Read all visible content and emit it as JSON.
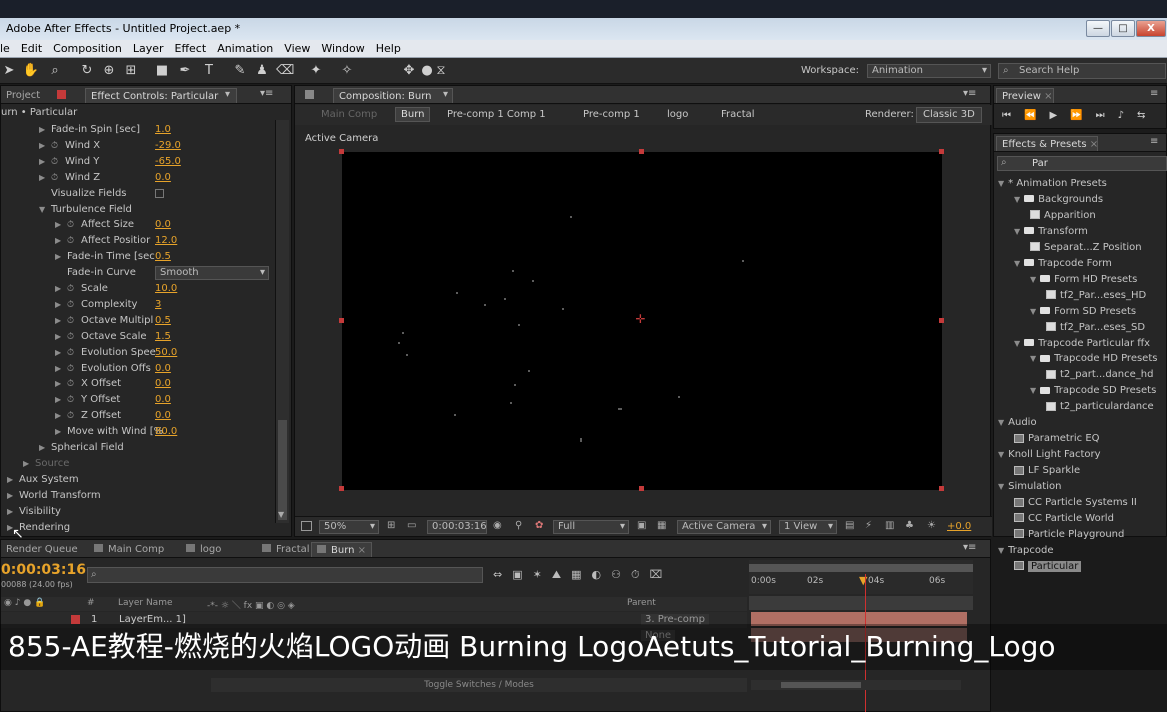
{
  "app": {
    "title": "Adobe After Effects - Untitled Project.aep *",
    "win_min": "—",
    "win_max": "□",
    "win_close": "X"
  },
  "menu": [
    "le",
    "Edit",
    "Composition",
    "Layer",
    "Effect",
    "Animation",
    "View",
    "Window",
    "Help"
  ],
  "workspace": {
    "label": "Workspace:",
    "value": "Animation",
    "search_placeholder": "Search Help"
  },
  "left_panel": {
    "tabs": [
      "Project",
      "Effect Controls: Particular"
    ],
    "header": "urn • Particular",
    "rows": [
      {
        "label": "Fade-in Spin [sec]",
        "value": "1.0",
        "indent": 40,
        "tri": true,
        "sw": false
      },
      {
        "label": "Wind X",
        "value": "-29.0",
        "indent": 40,
        "tri": true,
        "sw": true
      },
      {
        "label": "Wind Y",
        "value": "-65.0",
        "indent": 40,
        "tri": true,
        "sw": true
      },
      {
        "label": "Wind Z",
        "value": "0.0",
        "indent": 40,
        "tri": true,
        "sw": true
      },
      {
        "label": "Visualize Fields",
        "value": "",
        "indent": 40,
        "tri": false,
        "sw": false,
        "check": true
      },
      {
        "label": "Turbulence Field",
        "value": "",
        "indent": 40,
        "tri": true,
        "open": true,
        "sw": false
      },
      {
        "label": "Affect Size",
        "value": "0.0",
        "indent": 56,
        "tri": true,
        "sw": true
      },
      {
        "label": "Affect Positior",
        "value": "12.0",
        "indent": 56,
        "tri": true,
        "sw": true
      },
      {
        "label": "Fade-in Time [sec",
        "value": "0.5",
        "indent": 56,
        "tri": true,
        "sw": false
      },
      {
        "label": "Fade-in Curve",
        "value": "",
        "indent": 56,
        "tri": false,
        "sw": false,
        "dropdown": "Smooth"
      },
      {
        "label": "Scale",
        "value": "10.0",
        "indent": 56,
        "tri": true,
        "sw": true
      },
      {
        "label": "Complexity",
        "value": "3",
        "indent": 56,
        "tri": true,
        "sw": true
      },
      {
        "label": "Octave Multipl",
        "value": "0.5",
        "indent": 56,
        "tri": true,
        "sw": true
      },
      {
        "label": "Octave Scale",
        "value": "1.5",
        "indent": 56,
        "tri": true,
        "sw": true
      },
      {
        "label": "Evolution Spee",
        "value": "50.0",
        "indent": 56,
        "tri": true,
        "sw": true
      },
      {
        "label": "Evolution Offs",
        "value": "0.0",
        "indent": 56,
        "tri": true,
        "sw": true
      },
      {
        "label": "X Offset",
        "value": "0.0",
        "indent": 56,
        "tri": true,
        "sw": true
      },
      {
        "label": "Y Offset",
        "value": "0.0",
        "indent": 56,
        "tri": true,
        "sw": true
      },
      {
        "label": "Z Offset",
        "value": "0.0",
        "indent": 56,
        "tri": true,
        "sw": true
      },
      {
        "label": "Move with Wind [%",
        "value": "80.0",
        "indent": 56,
        "tri": true,
        "sw": false
      },
      {
        "label": "Spherical Field",
        "value": "",
        "indent": 40,
        "tri": true,
        "sw": false
      },
      {
        "label": "Source",
        "value": "",
        "indent": 24,
        "tri": true,
        "sw": false,
        "dim": true
      },
      {
        "label": "Aux System",
        "value": "",
        "indent": 8,
        "tri": true,
        "sw": false
      },
      {
        "label": "World Transform",
        "value": "",
        "indent": 8,
        "tri": true,
        "sw": false
      },
      {
        "label": "Visibility",
        "value": "",
        "indent": 8,
        "tri": true,
        "sw": false
      },
      {
        "label": "Rendering",
        "value": "",
        "indent": 8,
        "tri": true,
        "sw": false
      }
    ]
  },
  "composition": {
    "tab": "Composition: Burn",
    "breadcrumbs": [
      "Main Comp",
      "Burn",
      "Pre-comp 1 Comp 1",
      "Pre-comp 1",
      "logo",
      "Fractal"
    ],
    "renderer_label": "Renderer:",
    "renderer": "Classic 3D",
    "view_label": "Active Camera",
    "footer": {
      "zoom": "50%",
      "time": "0:00:03:16",
      "resolution": "Full",
      "camera": "Active Camera",
      "views": "1 View",
      "offset": "+0.0"
    }
  },
  "preview": {
    "tab": "Preview"
  },
  "effects": {
    "tab": "Effects & Presets",
    "search": "Par",
    "items": [
      {
        "text": "* Animation Presets",
        "indent": 0,
        "type": "cat"
      },
      {
        "text": "Backgrounds",
        "indent": 16,
        "type": "folder"
      },
      {
        "text": "Apparition",
        "indent": 32,
        "type": "preset"
      },
      {
        "text": "Transform",
        "indent": 16,
        "type": "folder"
      },
      {
        "text": "Separat...Z Position",
        "indent": 32,
        "type": "preset"
      },
      {
        "text": "Trapcode Form",
        "indent": 16,
        "type": "folder"
      },
      {
        "text": "Form HD Presets",
        "indent": 32,
        "type": "folder"
      },
      {
        "text": "tf2_Par...eses_HD",
        "indent": 48,
        "type": "preset"
      },
      {
        "text": "Form SD Presets",
        "indent": 32,
        "type": "folder"
      },
      {
        "text": "tf2_Par...eses_SD",
        "indent": 48,
        "type": "preset"
      },
      {
        "text": "Trapcode Particular ffx",
        "indent": 16,
        "type": "folder"
      },
      {
        "text": "Trapcode HD Presets",
        "indent": 32,
        "type": "folder"
      },
      {
        "text": "t2_part...dance_hd",
        "indent": 48,
        "type": "preset"
      },
      {
        "text": "Trapcode SD Presets",
        "indent": 32,
        "type": "folder"
      },
      {
        "text": "t2_particulardance",
        "indent": 48,
        "type": "preset"
      },
      {
        "text": "Audio",
        "indent": 0,
        "type": "cat"
      },
      {
        "text": "Parametric EQ",
        "indent": 16,
        "type": "fx"
      },
      {
        "text": "Knoll Light Factory",
        "indent": 0,
        "type": "cat"
      },
      {
        "text": "LF Sparkle",
        "indent": 16,
        "type": "fx"
      },
      {
        "text": "Simulation",
        "indent": 0,
        "type": "cat"
      },
      {
        "text": "CC Particle Systems II",
        "indent": 16,
        "type": "fx"
      },
      {
        "text": "CC Particle World",
        "indent": 16,
        "type": "fx"
      },
      {
        "text": "Particle Playground",
        "indent": 16,
        "type": "fx"
      },
      {
        "text": "Trapcode",
        "indent": 0,
        "type": "cat"
      },
      {
        "text": "Particular",
        "indent": 16,
        "type": "fx",
        "selected": true
      }
    ]
  },
  "timeline": {
    "tabs": [
      "Render Queue",
      "Main Comp",
      "logo",
      "Fractal",
      "Burn"
    ],
    "time": "0:00:03:16",
    "frames": "00088 (24.00 fps)",
    "col_layer": "Layer Name",
    "col_parent": "Parent",
    "layer_num": "1",
    "layer_name": "LayerEm... 1]",
    "parent_value": "3. Pre-comp",
    "parent_value2": "None",
    "ruler": [
      "0:00s",
      "02s",
      "04s",
      "06s"
    ],
    "toggle": "Toggle Switches / Modes"
  },
  "caption": "855-AE教程-燃烧的火焰LOGO动画 Burning LogoAetuts_Tutorial_Burning_Logo",
  "colors": {
    "accent": "#e7a32a",
    "handle": "#c43a3a",
    "selected": "#8a8a8a"
  }
}
